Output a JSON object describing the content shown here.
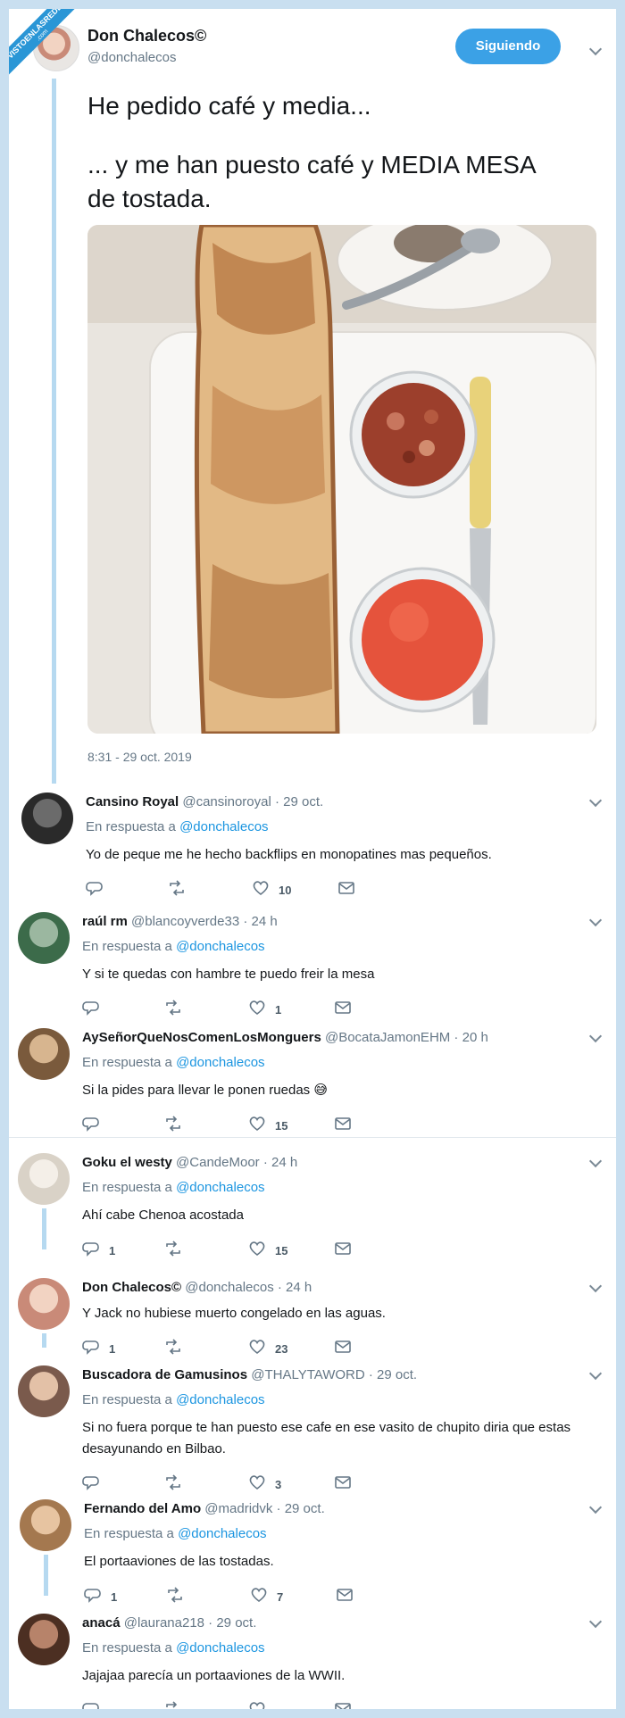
{
  "watermark": {
    "line1": "VISTOENLASREDES",
    "line2": ".com"
  },
  "tweet": {
    "name": "Don Chalecos©",
    "handle": "@donchalecos",
    "follow_label": "Siguiendo",
    "line1": "He pedido café y media...",
    "line2": "... y me han puesto café y MEDIA MESA",
    "line3": "de tostada.",
    "time": "8:31 - 29 oct. 2019",
    "photo_icon": "photo-toast-plate"
  },
  "replies": [
    {
      "name": "Cansino Royal",
      "meta": "@cansinoroyal · 29 oct.",
      "resp_prefix": "En respuesta a",
      "resp_handle": "@donchalecos",
      "text": "Yo de peque me he hecho backflips en monopatines mas pequeños.",
      "replies": "",
      "likes": "10"
    },
    {
      "name": "raúl rm",
      "meta": "@blancoyverde33 · 24 h",
      "resp_prefix": "En respuesta a",
      "resp_handle": "@donchalecos",
      "text": "Y si te quedas con hambre te puedo freir la mesa",
      "replies": "",
      "likes": "1"
    },
    {
      "name": "AySeñorQueNosComenLosMonguers",
      "meta": "@BocataJamonEHM · 20 h",
      "resp_prefix": "En respuesta a",
      "resp_handle": "@donchalecos",
      "text": "Si la pides para llevar le ponen ruedas 😅",
      "replies": "",
      "likes": "15"
    },
    {
      "name": "Goku el westy",
      "meta": "@CandeMoor · 24 h",
      "resp_prefix": "En respuesta a",
      "resp_handle": "@donchalecos",
      "text": "Ahí cabe Chenoa acostada",
      "replies": "1",
      "likes": "15"
    },
    {
      "name": "Don Chalecos©",
      "meta": "@donchalecos · 24 h",
      "text": "Y Jack no hubiese muerto congelado en  las aguas.",
      "replies": "1",
      "likes": "23"
    },
    {
      "name": "Buscadora de Gamusinos",
      "meta": "@THALYTAWORD · 29 oct.",
      "resp_prefix": "En respuesta a",
      "resp_handle": "@donchalecos",
      "text": "Si no fuera porque te han puesto ese cafe en ese vasito de chupito diria que estas desayunando en Bilbao.",
      "replies": "",
      "likes": "3"
    },
    {
      "name": "Fernando del Amo",
      "meta": "@madridvk · 29 oct.",
      "resp_prefix": "En respuesta a",
      "resp_handle": "@donchalecos",
      "text": "El portaaviones de las tostadas.",
      "replies": "1",
      "likes": "7"
    },
    {
      "name": "anacá",
      "meta": "@laurana218 · 29 oct.",
      "resp_prefix": "En respuesta a",
      "resp_handle": "@donchalecos",
      "text": "Jajajaa parecía un portaaviones de la WWII.",
      "replies": "",
      "likes": ""
    }
  ],
  "colors": {
    "accent": "#1b95e0",
    "button": "#3ba1e6",
    "thread_line": "#b6d9f0",
    "frame": "#c9dff0"
  }
}
